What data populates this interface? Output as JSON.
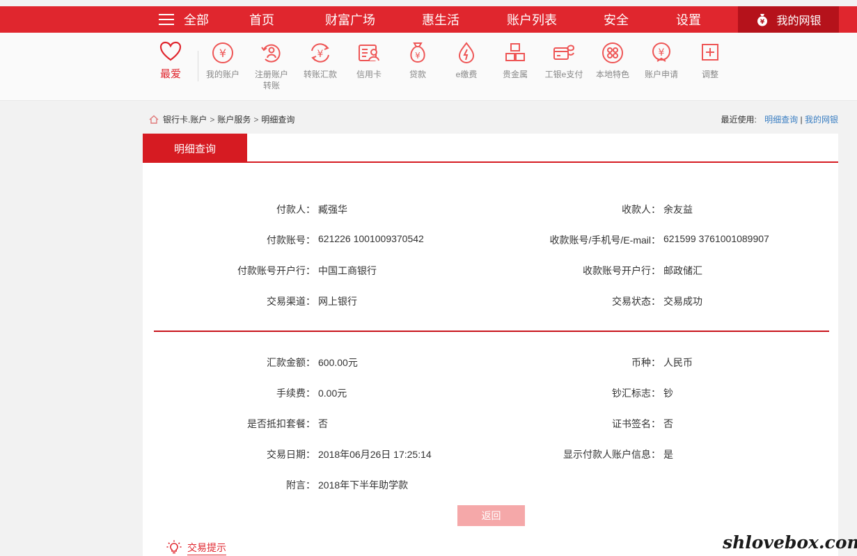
{
  "topnav": {
    "menu_label": "全部",
    "items": [
      "首页",
      "财富广场",
      "惠生活",
      "账户列表",
      "安全",
      "设置"
    ],
    "mybank_label": "我的网银"
  },
  "favorites": {
    "label": "最爱"
  },
  "quick_menu": [
    {
      "label": "我的账户",
      "icon": "yen-circle-icon"
    },
    {
      "label": "注册账户",
      "label2": "转账",
      "icon": "transfer-circle-icon"
    },
    {
      "label": "转账汇款",
      "icon": "yen-arrows-icon"
    },
    {
      "label": "信用卡",
      "icon": "credit-card-icon"
    },
    {
      "label": "贷款",
      "icon": "money-bag-icon"
    },
    {
      "label": "e缴费",
      "icon": "flame-icon"
    },
    {
      "label": "贵金属",
      "icon": "gold-bars-icon"
    },
    {
      "label": "工银e支付",
      "icon": "epay-icon"
    },
    {
      "label": "本地特色",
      "icon": "grid-circle-icon"
    },
    {
      "label": "账户申请",
      "icon": "yen-person-icon"
    },
    {
      "label": "调整",
      "icon": "plus-square-icon"
    }
  ],
  "breadcrumb": [
    "银行卡.账户",
    "账户服务",
    "明细查询"
  ],
  "recent": {
    "label": "最近使用:",
    "links": [
      "明细查询",
      "我的网银"
    ]
  },
  "tab": {
    "label": "明细查询"
  },
  "details_top": [
    {
      "left_label": "付款人：",
      "left_value": "臧强华",
      "right_label": "收款人：",
      "right_value": "余友益"
    },
    {
      "left_label": "付款账号：",
      "left_value": "621226 1001009370542",
      "right_label": "收款账号/手机号/E-mail：",
      "right_value": "621599 3761001089907"
    },
    {
      "left_label": "付款账号开户行：",
      "left_value": "中国工商银行",
      "right_label": "收款账号开户行：",
      "right_value": "邮政储汇"
    },
    {
      "left_label": "交易渠道：",
      "left_value": "网上银行",
      "right_label": "交易状态：",
      "right_value": "交易成功"
    }
  ],
  "details_bottom": [
    {
      "left_label": "汇款金额：",
      "left_value": "600.00元",
      "right_label": "币种：",
      "right_value": "人民币"
    },
    {
      "left_label": "手续费：",
      "left_value": "0.00元",
      "right_label": "钞汇标志：",
      "right_value": "钞"
    },
    {
      "left_label": "是否抵扣套餐：",
      "left_value": "否",
      "right_label": "证书签名：",
      "right_value": "否"
    },
    {
      "left_label": "交易日期：",
      "left_value": "2018年06月26日 17:25:14",
      "right_label": "显示付款人账户信息：",
      "right_value": "是"
    },
    {
      "left_label": "附言：",
      "left_value": "2018年下半年助学款"
    }
  ],
  "back_button": "返回",
  "tips_label": "交易提示",
  "watermark": "shlovebox.com",
  "colors": {
    "brand_red": "#e0262e",
    "dark_red": "#b5121b",
    "link_blue": "#3a7ec2",
    "button_pink": "#f5a8a9"
  }
}
